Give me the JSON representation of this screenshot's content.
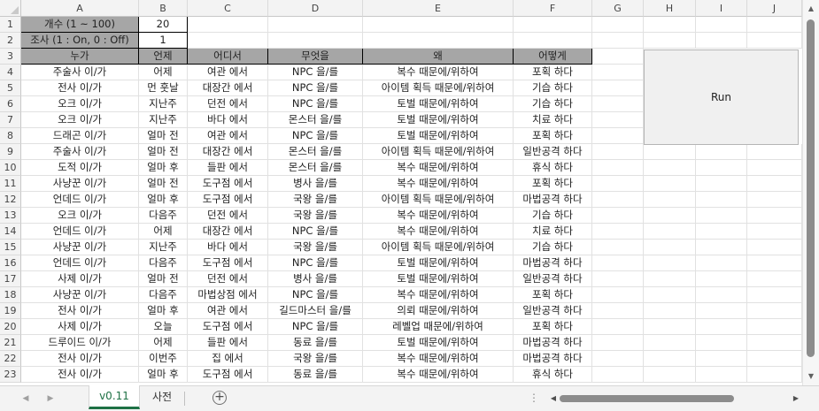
{
  "columns": [
    "A",
    "B",
    "C",
    "D",
    "E",
    "F",
    "G",
    "H",
    "I",
    "J"
  ],
  "rows": [
    "1",
    "2",
    "3",
    "4",
    "5",
    "6",
    "7",
    "8",
    "9",
    "10",
    "11",
    "12",
    "13",
    "14",
    "15",
    "16",
    "17",
    "18",
    "19",
    "20",
    "21",
    "22",
    "23"
  ],
  "settings": {
    "count_label": "개수 (1 ~ 100)",
    "count_value": "20",
    "survey_label": "조사 (1 : On, 0 : Off)",
    "survey_value": "1"
  },
  "table": {
    "headers": [
      "누가",
      "언제",
      "어디서",
      "무엇을",
      "왜",
      "어떻게"
    ],
    "rows": [
      [
        "주술사 이/가",
        "어제",
        "여관 에서",
        "NPC 을/를",
        "복수 때문에/위하여",
        "포획 하다"
      ],
      [
        "전사 이/가",
        "먼 훗날",
        "대장간 에서",
        "NPC 을/를",
        "아이템 획득 때문에/위하여",
        "기습 하다"
      ],
      [
        "오크 이/가",
        "지난주",
        "던전 에서",
        "NPC 을/를",
        "토벌 때문에/위하여",
        "기습 하다"
      ],
      [
        "오크 이/가",
        "지난주",
        "바다 에서",
        "몬스터 을/를",
        "토벌 때문에/위하여",
        "치료 하다"
      ],
      [
        "드래곤 이/가",
        "얼마 전",
        "여관 에서",
        "NPC 을/를",
        "토벌 때문에/위하여",
        "포획 하다"
      ],
      [
        "주술사 이/가",
        "얼마 전",
        "대장간 에서",
        "몬스터 을/를",
        "아이템 획득 때문에/위하여",
        "일반공격 하다"
      ],
      [
        "도적 이/가",
        "얼마 후",
        "들판 에서",
        "몬스터 을/를",
        "복수 때문에/위하여",
        "휴식 하다"
      ],
      [
        "사냥꾼 이/가",
        "얼마 전",
        "도구점 에서",
        "병사 을/를",
        "복수 때문에/위하여",
        "포획 하다"
      ],
      [
        "언데드 이/가",
        "얼마 후",
        "도구점 에서",
        "국왕 을/를",
        "아이템 획득 때문에/위하여",
        "마법공격 하다"
      ],
      [
        "오크 이/가",
        "다음주",
        "던전 에서",
        "국왕 을/를",
        "복수 때문에/위하여",
        "기습 하다"
      ],
      [
        "언데드 이/가",
        "어제",
        "대장간 에서",
        "NPC 을/를",
        "복수 때문에/위하여",
        "치료 하다"
      ],
      [
        "사냥꾼 이/가",
        "지난주",
        "바다 에서",
        "국왕 을/를",
        "아이템 획득 때문에/위하여",
        "기습 하다"
      ],
      [
        "언데드 이/가",
        "다음주",
        "도구점 에서",
        "NPC 을/를",
        "토벌 때문에/위하여",
        "마법공격 하다"
      ],
      [
        "사제 이/가",
        "얼마 전",
        "던전 에서",
        "병사 을/를",
        "토벌 때문에/위하여",
        "일반공격 하다"
      ],
      [
        "사냥꾼 이/가",
        "다음주",
        "마법상점 에서",
        "NPC 을/를",
        "복수 때문에/위하여",
        "포획 하다"
      ],
      [
        "전사 이/가",
        "얼마 후",
        "여관 에서",
        "길드마스터 을/를",
        "의뢰 때문에/위하여",
        "일반공격 하다"
      ],
      [
        "사제 이/가",
        "오늘",
        "도구점 에서",
        "NPC 을/를",
        "레벨업 때문에/위하여",
        "포획 하다"
      ],
      [
        "드루이드 이/가",
        "어제",
        "들판 에서",
        "동료 을/를",
        "토벌 때문에/위하여",
        "마법공격 하다"
      ],
      [
        "전사 이/가",
        "이번주",
        "집 에서",
        "국왕 을/를",
        "복수 때문에/위하여",
        "마법공격 하다"
      ],
      [
        "전사 이/가",
        "얼마 후",
        "도구점 에서",
        "동료 을/를",
        "복수 때문에/위하여",
        "휴식 하다"
      ]
    ]
  },
  "run_button": "Run",
  "sheet_tabs": [
    {
      "label": "v0.11",
      "active": true
    },
    {
      "label": "사전",
      "active": false
    }
  ],
  "icons": {
    "add_sheet": "plus-circle-icon",
    "nav_prev": "triangle-left-icon",
    "nav_next": "triangle-right-icon",
    "scroll_up": "triangle-up-icon",
    "scroll_down": "triangle-down-icon"
  },
  "colors": {
    "header_fill": "#a6a6a6",
    "active_tab": "#1e7145"
  }
}
